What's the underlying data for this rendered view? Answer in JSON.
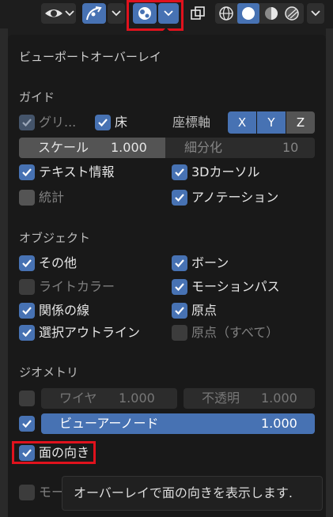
{
  "header": {
    "shading_modes": [
      "wireframe",
      "solid",
      "material-preview",
      "rendered"
    ],
    "active_shading": "solid"
  },
  "popup": {
    "title": "ビューポートオーバーレイ",
    "guides": {
      "section": "ガイド",
      "grid": "グリ...",
      "floor": "床",
      "axes_label": "座標軸",
      "axes": [
        "X",
        "Y",
        "Z"
      ],
      "scale_label": "スケール",
      "scale_value": "1.000",
      "subdiv_label": "細分化",
      "subdiv_value": "10",
      "text_info": "テキスト情報",
      "cursor_3d": "3Dカーソル",
      "statistics": "統計",
      "annotations": "アノテーション"
    },
    "objects": {
      "section": "オブジェクト",
      "extras": "その他",
      "bones": "ボーン",
      "light_colors": "ライトカラー",
      "motion_paths": "モーションパス",
      "relationship_lines": "関係の線",
      "origins": "原点",
      "outline_selected": "選択アウトライン",
      "origins_all": "原点（すべて）"
    },
    "geometry": {
      "section": "ジオメトリ",
      "wireframe_label": "ワイヤ",
      "wireframe_value": "1.000",
      "opacity_label": "不透明",
      "opacity_value": "1.000",
      "viewer_node_label": "ビューアーノード",
      "viewer_node_value": "1.000",
      "face_orientation": "面の向き",
      "motion_partial": "モー"
    },
    "tooltip": "オーバーレイで面の向きを表示します."
  },
  "colors": {
    "accent": "#4772b3",
    "highlight": "#e0121d",
    "background": "#191919"
  }
}
